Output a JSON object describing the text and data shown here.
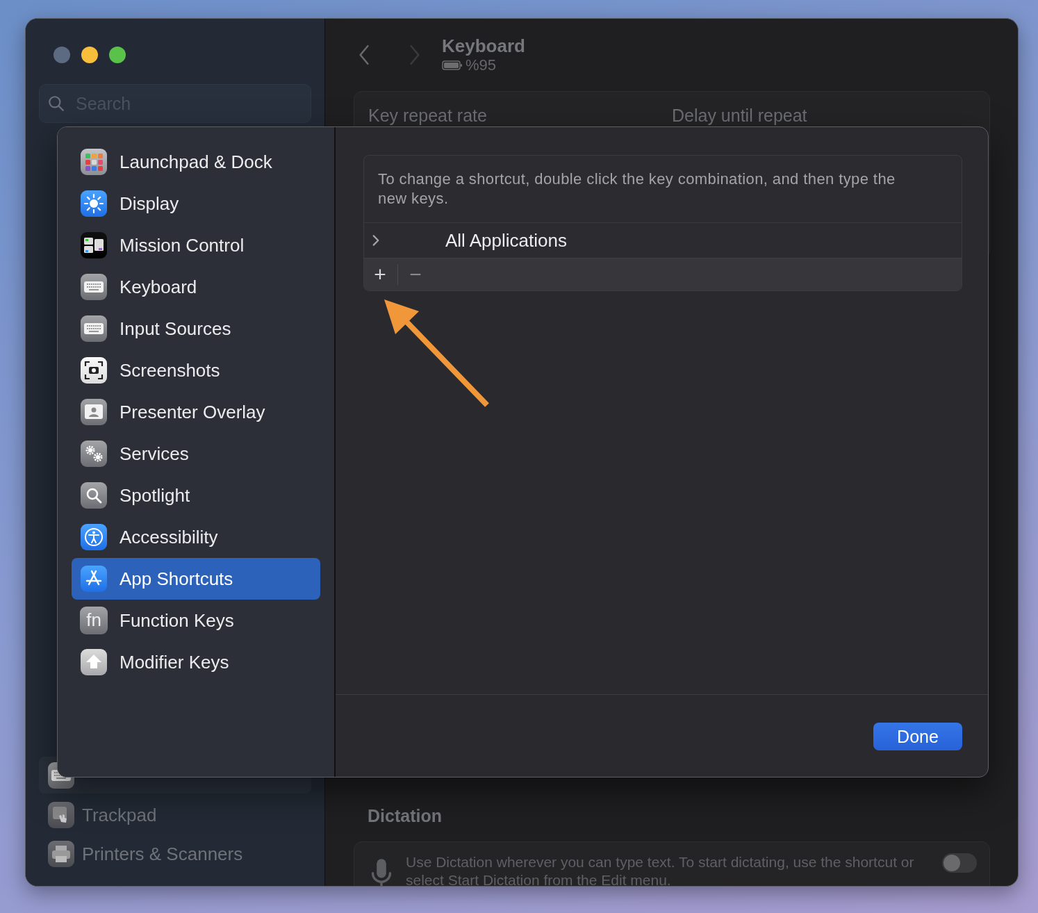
{
  "sidebar": {
    "search": {
      "placeholder": "Search"
    },
    "items": [
      {
        "kind": "keyboard",
        "selected": true
      },
      {
        "label": "Trackpad",
        "kind": "trackpad",
        "selected": false
      },
      {
        "label": "Printers & Scanners",
        "kind": "printer",
        "selected": false
      }
    ]
  },
  "header": {
    "back_disabled": false,
    "forward_disabled": true,
    "title": "Keyboard",
    "battery": "%95"
  },
  "key_settings": {
    "labels": [
      "Key repeat rate",
      "Delay until repeat"
    ]
  },
  "dictation": {
    "heading": "Dictation",
    "description": "Use Dictation wherever you can type text. To start dictating, use the shortcut or select Start Dictation from the Edit menu.",
    "on": false
  },
  "sheet": {
    "sidebar": {
      "items": [
        {
          "label": "Launchpad & Dock",
          "kind": "launchpad",
          "selected": false
        },
        {
          "label": "Display",
          "kind": "display",
          "selected": false
        },
        {
          "label": "Mission Control",
          "kind": "mission",
          "selected": false
        },
        {
          "label": "Keyboard",
          "kind": "keyboard",
          "selected": false
        },
        {
          "label": "Input Sources",
          "kind": "keyboard",
          "selected": false
        },
        {
          "label": "Screenshots",
          "kind": "screenshot",
          "selected": false
        },
        {
          "label": "Presenter Overlay",
          "kind": "presenter",
          "selected": false
        },
        {
          "label": "Services",
          "kind": "services",
          "selected": false
        },
        {
          "label": "Spotlight",
          "kind": "spotlight",
          "selected": false
        },
        {
          "label": "Accessibility",
          "kind": "accessibility",
          "selected": false
        },
        {
          "label": "App Shortcuts",
          "kind": "appstore",
          "selected": true
        },
        {
          "label": "Function Keys",
          "kind": "fn",
          "icon_text": "fn",
          "selected": false
        },
        {
          "label": "Modifier Keys",
          "kind": "shift",
          "selected": false
        }
      ]
    },
    "instructions": "To change a shortcut, double click the key combination, and then type the new keys.",
    "groups": [
      {
        "label": "All Applications",
        "expanded": false
      }
    ],
    "add": "+",
    "remove": "−",
    "done": "Done"
  }
}
